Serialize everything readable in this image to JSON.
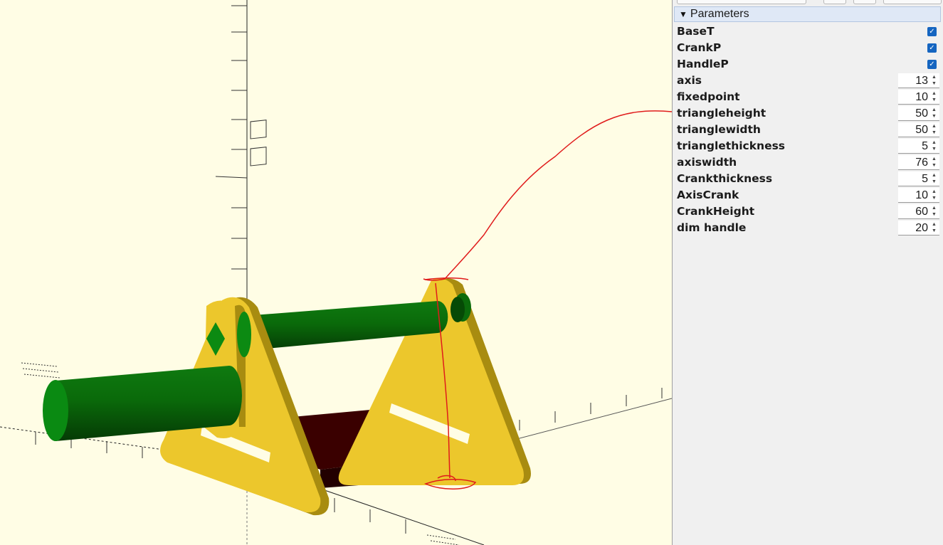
{
  "parameters_panel": {
    "group_title": "Parameters",
    "checkbox_params": [
      {
        "label": "BaseT",
        "checked": true
      },
      {
        "label": "CrankP",
        "checked": true
      },
      {
        "label": "HandleP",
        "checked": true
      }
    ],
    "number_params": [
      {
        "label": "axis",
        "value": "13"
      },
      {
        "label": "fixedpoint",
        "value": "10"
      },
      {
        "label": "triangleheight",
        "value": "50"
      },
      {
        "label": "trianglewidth",
        "value": "50"
      },
      {
        "label": "trianglethickness",
        "value": "5"
      },
      {
        "label": "axiswidth",
        "value": "76"
      },
      {
        "label": "Crankthickness",
        "value": "5"
      },
      {
        "label": "AxisCrank",
        "value": "10"
      },
      {
        "label": "CrankHeight",
        "value": "60"
      },
      {
        "label": "dim handle",
        "value": "20"
      }
    ]
  },
  "colors": {
    "viewport_background": "#fffde5",
    "part_yellow": "#f0cd2e",
    "part_green": "#0a8a12",
    "part_dark_red": "#3a0000",
    "annotation_red": "#e01b1b",
    "checkbox_blue": "#1565c0"
  }
}
